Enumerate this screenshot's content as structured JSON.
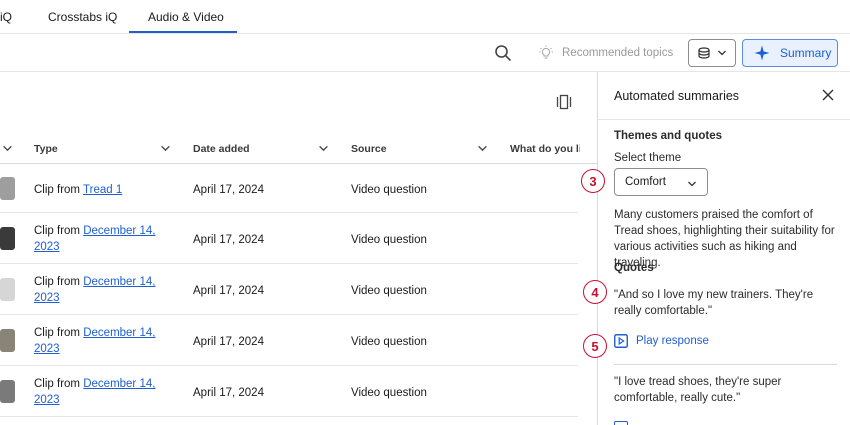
{
  "tabs": [
    {
      "label": "iQ"
    },
    {
      "label": "Crosstabs iQ"
    },
    {
      "label": "Audio & Video",
      "active": true
    }
  ],
  "toolbar": {
    "recommended_topics_label": "Recommended topics",
    "summary_label": "Summary"
  },
  "table": {
    "headers": [
      "Type",
      "Date added",
      "Source",
      "What do you lik"
    ],
    "rows": [
      {
        "type_prefix": "Clip from",
        "link": "Tread 1",
        "link_line2": "",
        "date": "April 17, 2024",
        "source": "Video question",
        "thumb_color": "#9e9e9e"
      },
      {
        "type_prefix": "Clip from",
        "link": "December 14,",
        "link_line2": "2023",
        "date": "April 17, 2024",
        "source": "Video question",
        "thumb_color": "#3a3a3a"
      },
      {
        "type_prefix": "Clip from",
        "link": "December 14,",
        "link_line2": "2023",
        "date": "April 17, 2024",
        "source": "Video question",
        "thumb_color": "#d6d6d6"
      },
      {
        "type_prefix": "Clip from",
        "link": "December 14,",
        "link_line2": "2023",
        "date": "April 17, 2024",
        "source": "Video question",
        "thumb_color": "#8a8378"
      },
      {
        "type_prefix": "Clip from",
        "link": "December 14,",
        "link_line2": "2023",
        "date": "April 17, 2024",
        "source": "Video question",
        "thumb_color": "#7a7a7a"
      }
    ]
  },
  "panel": {
    "title": "Automated summaries",
    "section_title": "Themes and quotes",
    "select_label": "Select theme",
    "selected_theme": "Comfort",
    "summary_text": "Many customers praised the comfort of Tread shoes, highlighting their suitability for various activities such as hiking and traveling.",
    "quotes_title": "Quotes",
    "quotes": [
      "\"And so I love my new trainers. They're really comfortable.\"",
      "\"I love tread shoes, they're super comfortable, really cute.\""
    ],
    "play_response_label": "Play response"
  },
  "callouts": [
    "3",
    "4",
    "5"
  ],
  "colors": {
    "accent": "#1f5fd1",
    "callout": "#c8102e"
  }
}
